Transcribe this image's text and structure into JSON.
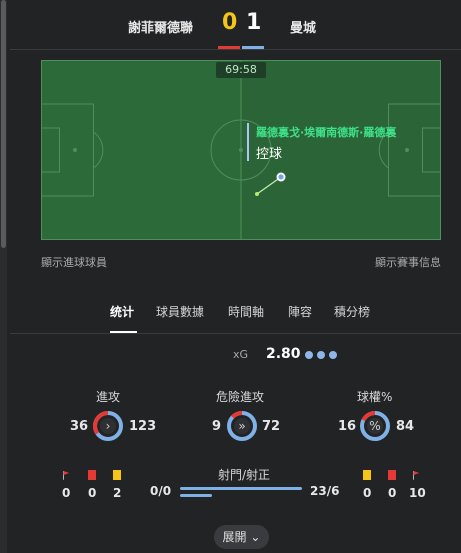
{
  "match": {
    "home_team": "謝菲爾德聯",
    "away_team": "曼城",
    "home_score": "0",
    "away_score": "1",
    "clock": "69:58",
    "player_name": "羅德裏戈·埃爾南德斯·羅德裏",
    "action": "控球"
  },
  "links": {
    "show_scorers": "顯示進球球員",
    "show_info": "顯示賽事信息"
  },
  "tabs": [
    "统计",
    "球員數據",
    "時間軸",
    "陣容",
    "積分榜"
  ],
  "xg": {
    "label": "xG",
    "value": "2.80"
  },
  "stats": {
    "attacks": {
      "title": "進攻",
      "home": "36",
      "away": "123"
    },
    "dangerous": {
      "title": "危險進攻",
      "home": "9",
      "away": "72"
    },
    "possession": {
      "title": "球權%",
      "home": "16",
      "away": "84"
    }
  },
  "cards": {
    "home_corners": "0",
    "home_red": "0",
    "home_yellow": "2",
    "away_yellow": "0",
    "away_red": "0",
    "away_corners": "10"
  },
  "shots": {
    "title": "射門/射正",
    "home": "0/0",
    "away": "23/6"
  },
  "expand": {
    "label": "展開"
  },
  "colors": {
    "home": "#e53935",
    "away": "#7fb0e6",
    "pitch": "#2e6b3a",
    "yellow": "#f5c518"
  }
}
